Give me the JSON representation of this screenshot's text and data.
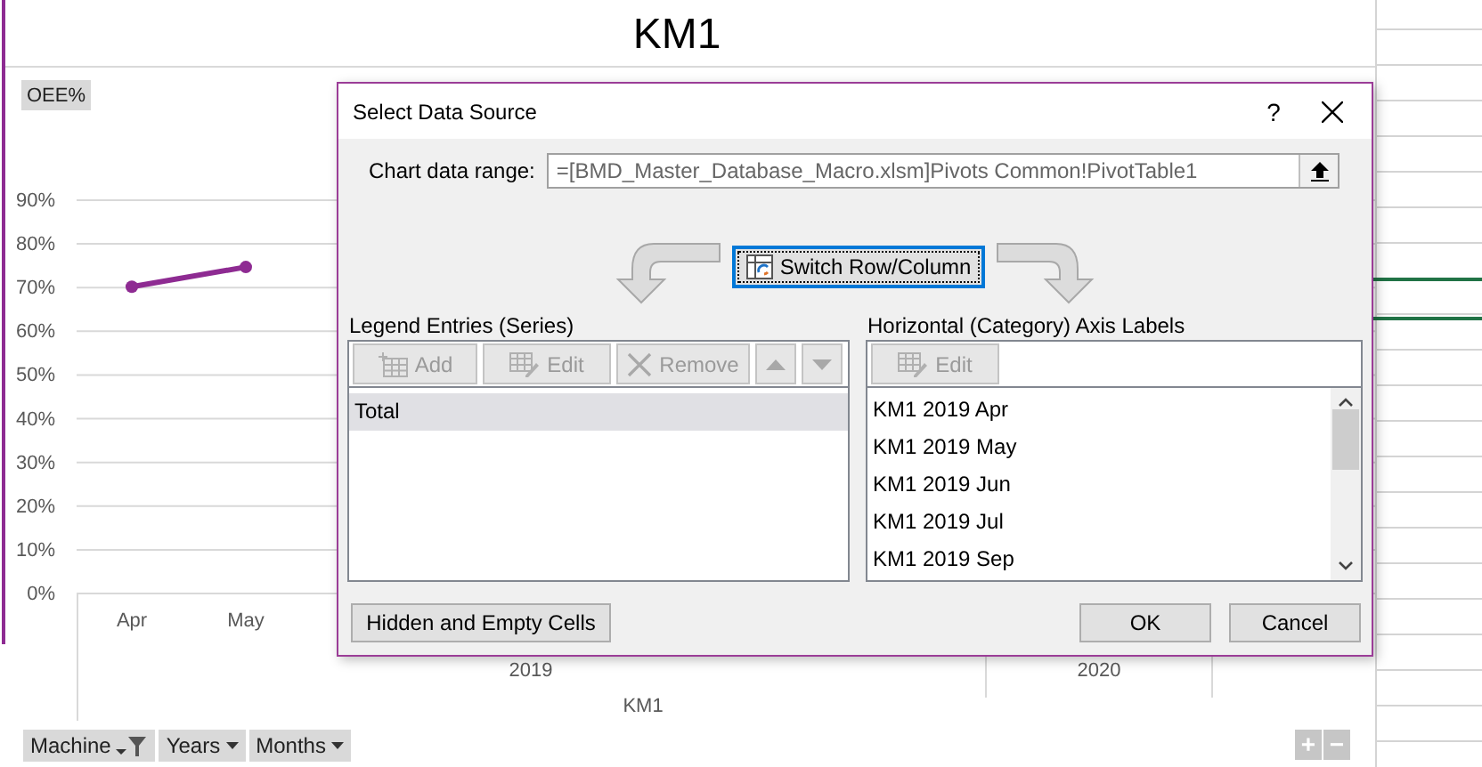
{
  "chart": {
    "title": "KM1",
    "field_label": "OEE%",
    "chart_data": {
      "type": "line",
      "categories": [
        "Apr",
        "May"
      ],
      "series": [
        {
          "color": "#8e2b92",
          "marker": true,
          "values": [
            70,
            74.5
          ]
        }
      ],
      "grid": true,
      "ylim": [
        0,
        90
      ],
      "yticks": [
        {
          "value": 0,
          "label": "0%"
        },
        {
          "value": 10,
          "label": "10%"
        },
        {
          "value": 20,
          "label": "20%"
        },
        {
          "value": 30,
          "label": "30%"
        },
        {
          "value": 40,
          "label": "40%"
        },
        {
          "value": 50,
          "label": "50%"
        },
        {
          "value": 60,
          "label": "60%"
        },
        {
          "value": 70,
          "label": "70%"
        },
        {
          "value": 80,
          "label": "80%"
        },
        {
          "value": 90,
          "label": "90%"
        }
      ]
    },
    "group_labels": [
      "2019",
      "2020"
    ],
    "axis_title": "KM1",
    "field_buttons": [
      {
        "label": "Machine",
        "kind": "filter"
      },
      {
        "label": "Years",
        "kind": "dropdown"
      },
      {
        "label": "Months",
        "kind": "dropdown"
      }
    ],
    "zoom_buttons": [
      "+",
      "−"
    ]
  },
  "dialog": {
    "title": "Select Data Source",
    "help": "?",
    "range_label": "Chart data range:",
    "range_value": "=[BMD_Master_Database_Macro.xlsm]Pivots Common!PivotTable1",
    "switch_button": "Switch Row/Column",
    "legend": {
      "heading": "Legend Entries (Series)",
      "buttons": [
        {
          "kind": "add",
          "label": "Add",
          "disabled": true
        },
        {
          "kind": "edit",
          "label": "Edit",
          "disabled": true
        },
        {
          "kind": "remove",
          "label": "Remove",
          "disabled": true
        },
        {
          "kind": "move_up",
          "disabled": true
        },
        {
          "kind": "move_down",
          "disabled": true
        }
      ],
      "entries": [
        {
          "label": "Total",
          "selected": true
        }
      ]
    },
    "axis": {
      "heading": "Horizontal (Category) Axis Labels",
      "buttons": [
        {
          "kind": "edit",
          "label": "Edit",
          "disabled": true
        }
      ],
      "items": [
        {
          "label": "KM1 2019 Apr",
          "selected": false
        },
        {
          "label": "KM1 2019 May",
          "selected": false
        },
        {
          "label": "KM1 2019 Jun",
          "selected": false
        },
        {
          "label": "KM1 2019 Jul",
          "selected": false
        },
        {
          "label": "KM1 2019 Sep",
          "selected": false
        }
      ]
    },
    "hidden_cells_button": "Hidden and Empty Cells",
    "buttons": [
      "OK",
      "Cancel"
    ]
  }
}
